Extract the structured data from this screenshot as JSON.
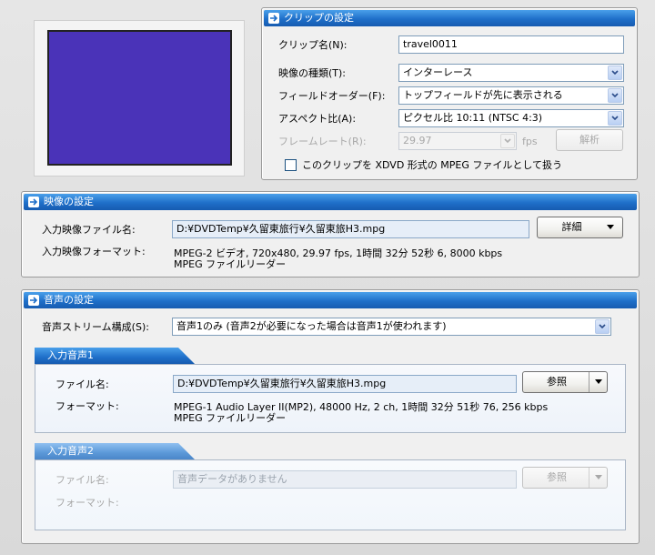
{
  "preview": {
    "color": "#4a33b8"
  },
  "clip": {
    "header": "クリップの設定",
    "name_label": "クリップ名(N):",
    "name_value": "travel0011",
    "video_type_label": "映像の種類(T):",
    "video_type_value": "インターレース",
    "field_order_label": "フィールドオーダー(F):",
    "field_order_value": "トップフィールドが先に表示される",
    "aspect_label": "アスペクト比(A):",
    "aspect_value": "ピクセル比 10:11 (NTSC 4:3)",
    "framerate_label": "フレームレート(R):",
    "framerate_value": "29.97",
    "framerate_unit": "fps",
    "analyze_button": "解析",
    "xdvd_checkbox_label": "このクリップを XDVD 形式の MPEG ファイルとして扱う",
    "xdvd_checked": false
  },
  "video": {
    "header": "映像の設定",
    "file_label": "入力映像ファイル名:",
    "file_value": "D:¥DVDTemp¥久留東旅行¥久留東旅H3.mpg",
    "details_button": "詳細",
    "format_label": "入力映像フォーマット:",
    "format_line1": "MPEG-2 ビデオ, 720x480, 29.97 fps, 1時間 32分 52秒 6, 8000 kbps",
    "format_line2": "MPEG ファイルリーダー"
  },
  "audio": {
    "header": "音声の設定",
    "stream_label": "音声ストリーム構成(S):",
    "stream_value": "音声1のみ (音声2が必要になった場合は音声1が使われます)",
    "input1": {
      "tab": "入力音声1",
      "file_label": "ファイル名:",
      "file_value": "D:¥DVDTemp¥久留東旅行¥久留東旅H3.mpg",
      "browse_button": "参照",
      "format_label": "フォーマット:",
      "format_line1": "MPEG-1 Audio Layer II(MP2), 48000 Hz, 2 ch, 1時間 32分 51秒 76, 256 kbps",
      "format_line2": "MPEG ファイルリーダー"
    },
    "input2": {
      "tab": "入力音声2",
      "file_label": "ファイル名:",
      "file_placeholder": "音声データがありません",
      "browse_button": "参照",
      "format_label": "フォーマット:"
    }
  }
}
